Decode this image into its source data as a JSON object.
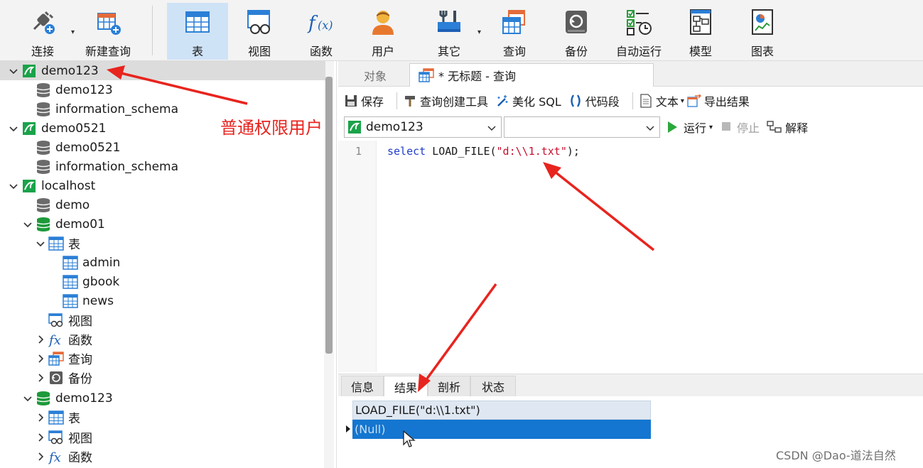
{
  "toolbar": {
    "items": [
      {
        "label": "连接",
        "icon": "connect-plug-icon"
      },
      {
        "label": "新建查询",
        "icon": "new-query-icon"
      },
      {
        "label": "表",
        "icon": "table-icon",
        "active": true
      },
      {
        "label": "视图",
        "icon": "view-icon"
      },
      {
        "label": "函数",
        "icon": "function-icon"
      },
      {
        "label": "用户",
        "icon": "user-icon"
      },
      {
        "label": "其它",
        "icon": "tools-icon"
      },
      {
        "label": "查询",
        "icon": "query-icon"
      },
      {
        "label": "备份",
        "icon": "backup-icon"
      },
      {
        "label": "自动运行",
        "icon": "auto-run-icon"
      },
      {
        "label": "模型",
        "icon": "model-icon"
      },
      {
        "label": "图表",
        "icon": "chart-icon"
      }
    ]
  },
  "tree": {
    "rows": [
      {
        "label": "demo123",
        "kind": "connection",
        "expanded": true,
        "selected": true
      },
      {
        "label": "demo123",
        "kind": "database"
      },
      {
        "label": "information_schema",
        "kind": "database"
      },
      {
        "label": "demo0521",
        "kind": "connection",
        "expanded": true
      },
      {
        "label": "demo0521",
        "kind": "database"
      },
      {
        "label": "information_schema",
        "kind": "database"
      },
      {
        "label": "localhost",
        "kind": "connection",
        "expanded": true
      },
      {
        "label": "demo",
        "kind": "database"
      },
      {
        "label": "demo01",
        "kind": "database-open",
        "expanded": true
      },
      {
        "label": "表",
        "kind": "tables-folder",
        "expanded": true
      },
      {
        "label": "admin",
        "kind": "table"
      },
      {
        "label": "gbook",
        "kind": "table"
      },
      {
        "label": "news",
        "kind": "table"
      },
      {
        "label": "视图",
        "kind": "views-folder"
      },
      {
        "label": "函数",
        "kind": "functions-folder",
        "collapsed": true
      },
      {
        "label": "查询",
        "kind": "queries-folder",
        "collapsed": true
      },
      {
        "label": "备份",
        "kind": "backups-folder",
        "collapsed": true
      },
      {
        "label": "demo123",
        "kind": "database-open",
        "expanded": true
      },
      {
        "label": "表",
        "kind": "tables-folder",
        "collapsed": true
      },
      {
        "label": "视图",
        "kind": "views-folder",
        "collapsed": true
      },
      {
        "label": "函数",
        "kind": "functions-folder",
        "collapsed": true
      }
    ]
  },
  "tabs": {
    "objects": "对象",
    "query": "* 无标题 - 查询"
  },
  "query_toolbar": {
    "save": "保存",
    "builder": "查询创建工具",
    "beautify": "美化 SQL",
    "snippet": "代码段",
    "text": "文本",
    "export": "导出结果"
  },
  "selectors": {
    "connection": "demo123",
    "database": "",
    "run": "运行",
    "stop": "停止",
    "explain": "解释"
  },
  "editor": {
    "line_number": "1",
    "keyword": "select",
    "func": " LOAD_FILE(",
    "string": "\"d:\\\\1.txt\"",
    "tail": ");"
  },
  "bottom_tabs": [
    "信息",
    "结果",
    "剖析",
    "状态"
  ],
  "results": {
    "column": "LOAD_FILE(\"d:\\\\1.txt\")",
    "value": "(Null)"
  },
  "annotation": "普通权限用户",
  "watermark": "CSDN @Dao-道法自然",
  "colors": {
    "accent": "#1476d0",
    "arrow": "#e8241e",
    "active_tab": "#cfe3f7"
  }
}
